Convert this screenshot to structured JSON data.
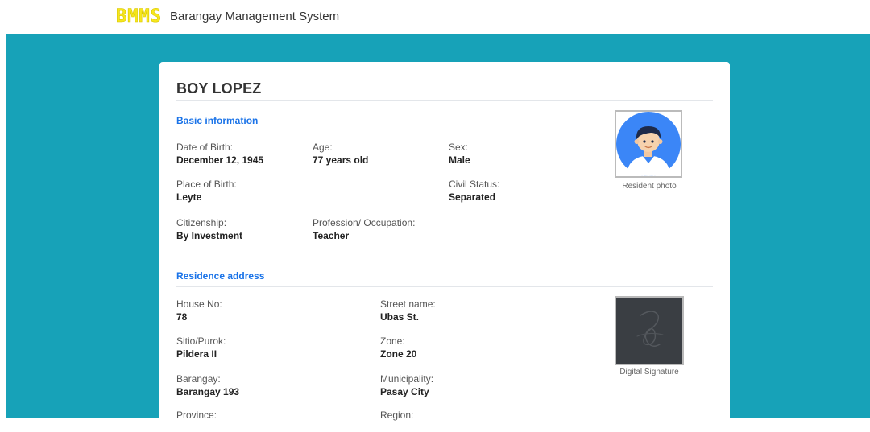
{
  "header": {
    "logo_text": "BMMS",
    "app_title": "Barangay Management System"
  },
  "resident": {
    "name": "BOY LOPEZ",
    "photo_caption": "Resident photo",
    "signature_caption": "Digital Signature"
  },
  "basic": {
    "heading": "Basic information",
    "fields": [
      {
        "label": "Date of Birth:",
        "value": "December 12, 1945"
      },
      {
        "label": "Age:",
        "value": "77 years old"
      },
      {
        "label": "Sex:",
        "value": "Male"
      },
      {
        "label": "Place of Birth:",
        "value": "Leyte"
      },
      {
        "label": "Civil Status:",
        "value": "Separated"
      },
      {
        "label": "Citizenship:",
        "value": "By Investment"
      },
      {
        "label": "Profession/ Occupation:",
        "value": "Teacher"
      }
    ]
  },
  "residence": {
    "heading": "Residence address",
    "fields": [
      {
        "label": "House No:",
        "value": "78"
      },
      {
        "label": "Street name:",
        "value": "Ubas St."
      },
      {
        "label": "Sitio/Purok:",
        "value": "Pildera II"
      },
      {
        "label": "Zone:",
        "value": "Zone 20"
      },
      {
        "label": "Barangay:",
        "value": "Barangay 193"
      },
      {
        "label": "Municipality:",
        "value": "Pasay City"
      },
      {
        "label": "Province:",
        "value": ""
      },
      {
        "label": "Region:",
        "value": ""
      }
    ]
  },
  "icons": {
    "avatar": "user-avatar-icon",
    "signature": "signature-scribble-icon"
  },
  "colors": {
    "teal_background": "#17a2b8",
    "section_heading": "#1a73e8",
    "logo": "#f6e71d",
    "avatar_circle": "#3b86f7"
  }
}
